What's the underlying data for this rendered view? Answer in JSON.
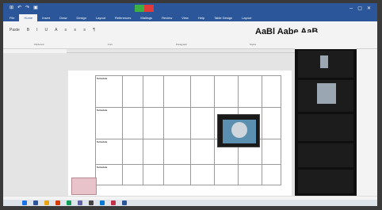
{
  "titlebar": {
    "quick_icons": [
      "⊞",
      "↶",
      "↷",
      "▣"
    ],
    "title": "",
    "meeting_left": "",
    "meeting_right": "",
    "window_controls": [
      "─",
      "▢",
      "✕"
    ]
  },
  "tabs": [
    "File",
    "Home",
    "Insert",
    "Draw",
    "Design",
    "Layout",
    "References",
    "Mailings",
    "Review",
    "View",
    "Help",
    "Table Design",
    "Layout"
  ],
  "ribbon": {
    "heading": "AaBl Aabe AaB",
    "row1": [
      "Paste",
      "B",
      "I",
      "U",
      "A",
      "≡",
      "≡",
      "≡",
      "¶"
    ],
    "groups": [
      "Clipboard",
      "Font",
      "Paragraph",
      "Styles",
      "Editing"
    ]
  },
  "table": {
    "rows": [
      {
        "label": "Schedule",
        "c1": "",
        "c2": "",
        "c3": "",
        "tall": true
      },
      {
        "label": "Schedule",
        "c1": "",
        "c2": "",
        "c3": "",
        "tall": true
      },
      {
        "label": "Schedule",
        "c1": "",
        "c2": "",
        "c3": "",
        "tall": false
      },
      {
        "label": "Schedule",
        "c1": "",
        "c2": "",
        "c3": "",
        "tall": false
      }
    ]
  },
  "sticky": "",
  "sidepane": {
    "header": [
      "",
      ""
    ],
    "participants": [
      {
        "name": ""
      },
      {
        "name": ""
      },
      {
        "name": ""
      },
      {
        "name": ""
      },
      {
        "name": ""
      }
    ]
  },
  "status": [],
  "taskbar": {
    "icon_colors": [
      "#1a73e8",
      "#2b579a",
      "#e8a317",
      "#d83b01",
      "#0f9d58",
      "#6264a7",
      "#444444",
      "#0078d4",
      "#c4314b",
      "#2b579a"
    ],
    "clock": ""
  }
}
